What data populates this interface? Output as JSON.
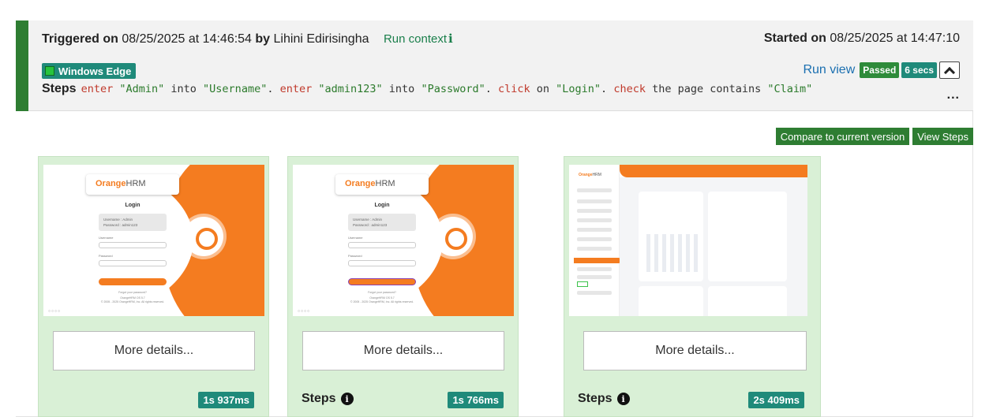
{
  "header": {
    "triggered_label": "Triggered on",
    "triggered_datetime": "08/25/2025 at 14:46:54",
    "by_label": "by",
    "user": "Lihini Edirisingha",
    "run_context_label": "Run context",
    "run_context_icon": "info-icon",
    "started_label": "Started on",
    "started_datetime": "08/25/2025 at 14:47:10",
    "browser_badge": "Windows Edge",
    "run_view_label": "Run view",
    "status_badge": "Passed",
    "duration_badge": "6 secs",
    "steps_label": "Steps",
    "steps": [
      {
        "kw": "enter",
        "text": " "
      },
      {
        "str": "\"Admin\"",
        "text": " into "
      },
      {
        "str": "\"Username\"",
        "text": ". "
      },
      {
        "kw": "enter",
        "text": " "
      },
      {
        "str": "\"admin123\"",
        "text": " into "
      },
      {
        "str": "\"Password\"",
        "text": ". "
      },
      {
        "kw": "click",
        "text": " on "
      },
      {
        "str": "\"Login\"",
        "text": ". "
      },
      {
        "kw": "check",
        "text": " the page contains "
      },
      {
        "str": "\"Claim\"",
        "text": ""
      }
    ],
    "more_icon": "ellipsis-icon",
    "colors": {
      "accent": "#2e7d32",
      "teal": "#1f8a7a",
      "link_blue": "#1a6fb0"
    }
  },
  "actions": {
    "compare_label": "Compare to current version",
    "view_steps_label": "View Steps"
  },
  "cards": [
    {
      "details_label": "More details...",
      "steps_label": "",
      "duration": "1s 937ms",
      "screenshot": "login-page"
    },
    {
      "details_label": "More details...",
      "steps_label": "Steps",
      "duration": "1s 766ms",
      "screenshot": "login-page-filled"
    },
    {
      "details_label": "More details...",
      "steps_label": "Steps",
      "duration": "2s 409ms",
      "screenshot": "dashboard"
    }
  ],
  "screenshots": {
    "login": {
      "brand": "Orange",
      "brand_suffix": "HRM",
      "title": "Login",
      "credentials": [
        "Username : Admin",
        "Password : admin123"
      ],
      "username_label": "Username",
      "password_label": "Password",
      "forgot": "Forgot your password?",
      "footer": [
        "OrangeHRM OS 5.7",
        "© 2005 - 2025 OrangeHRM, Inc. All rights reserved."
      ]
    }
  }
}
